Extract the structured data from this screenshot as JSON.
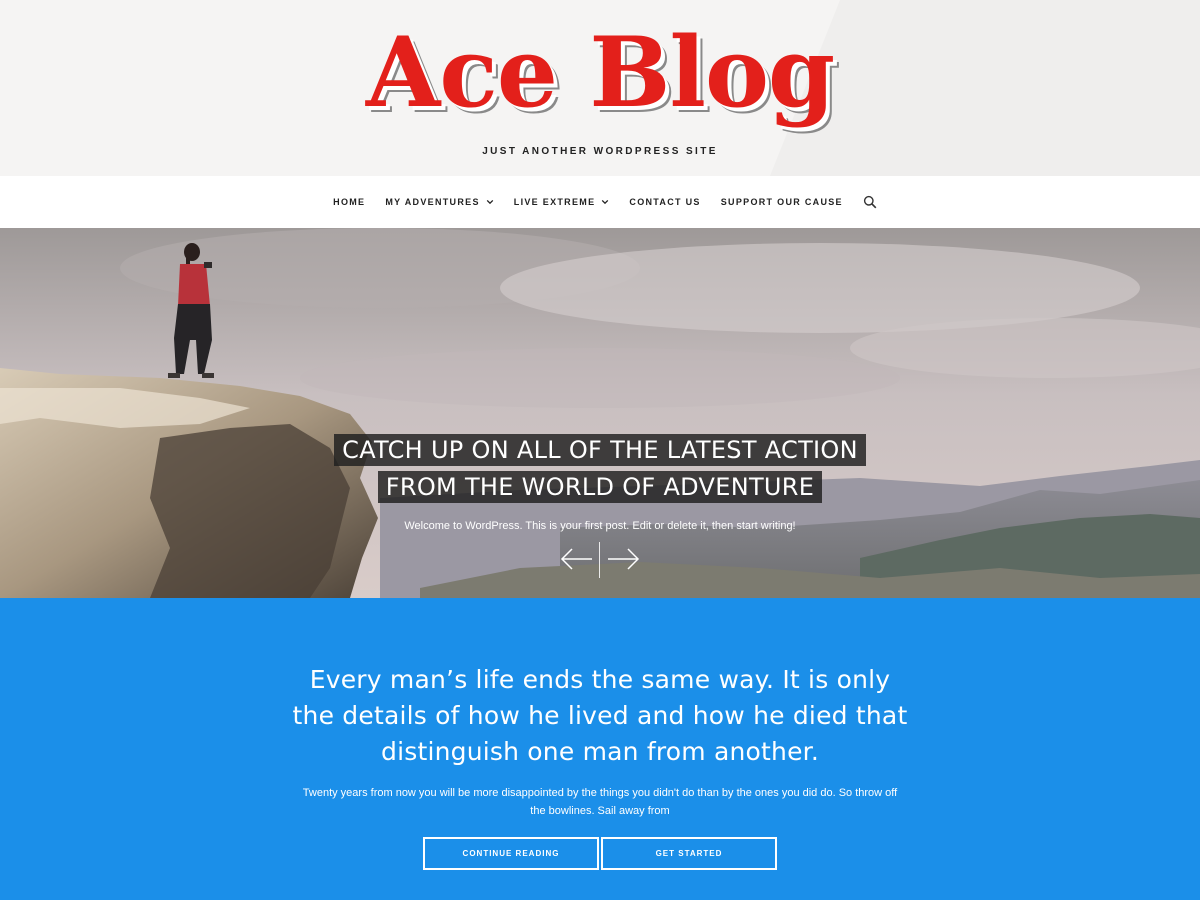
{
  "header": {
    "site_title": "Ace Blog",
    "tagline": "JUST ANOTHER WORDPRESS SITE"
  },
  "nav": {
    "items": [
      {
        "label": "HOME",
        "has_dropdown": false
      },
      {
        "label": "MY ADVENTURES",
        "has_dropdown": true
      },
      {
        "label": "LIVE EXTREME",
        "has_dropdown": true
      },
      {
        "label": "CONTACT US",
        "has_dropdown": false
      },
      {
        "label": "SUPPORT OUR CAUSE",
        "has_dropdown": false
      }
    ],
    "search_icon": "search-icon"
  },
  "hero": {
    "title_line1": "CATCH UP ON ALL OF THE LATEST ACTION",
    "title_line2": "FROM THE WORLD OF ADVENTURE",
    "subtitle": "Welcome to WordPress. This is your first post. Edit or delete it, then start writing!",
    "prev_icon": "arrow-left-icon",
    "next_icon": "arrow-right-icon"
  },
  "quote": {
    "text": "Every man’s life ends the same way. It is only the details of how he lived and how he died that distinguish one man from another.",
    "sub": "Twenty years from now you will be more disappointed by the things you didn't do than by the ones you did do. So throw off the bowlines. Sail away from",
    "continue_label": "CONTINUE READING",
    "started_label": "GET STARTED"
  },
  "colors": {
    "title_red": "#e3201b",
    "section_blue": "#1b8fe9",
    "text_dark": "#222222"
  }
}
